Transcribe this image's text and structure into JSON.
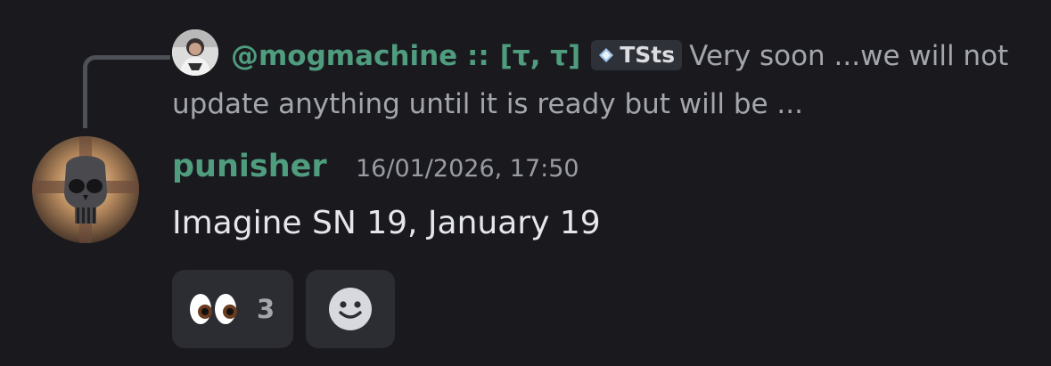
{
  "reply": {
    "author": "@mogmachine ::",
    "tag": "[τ, τ]",
    "badge": "TSts",
    "badge_icon": "diamond-sparkle-icon",
    "text": "Very soon ...we will not update anything until it is ready but will be ...",
    "avatar_icon": "person-avatar-icon"
  },
  "message": {
    "author": "punisher",
    "timestamp": "16/01/2026, 17:50",
    "content": "Imagine SN 19, January 19",
    "avatar_icon": "punisher-skull-avatar-icon",
    "author_color": "#4f9c7e"
  },
  "reactions": [
    {
      "emoji": "👀",
      "icon": "eyes-icon",
      "count": "3"
    }
  ],
  "add_reaction": {
    "icon": "smiley-add-reaction-icon"
  },
  "colors": {
    "background": "#1a1a1e",
    "accent": "#4f9c7e",
    "muted_text": "#a3a6ad",
    "pill": "#2b2d32"
  }
}
